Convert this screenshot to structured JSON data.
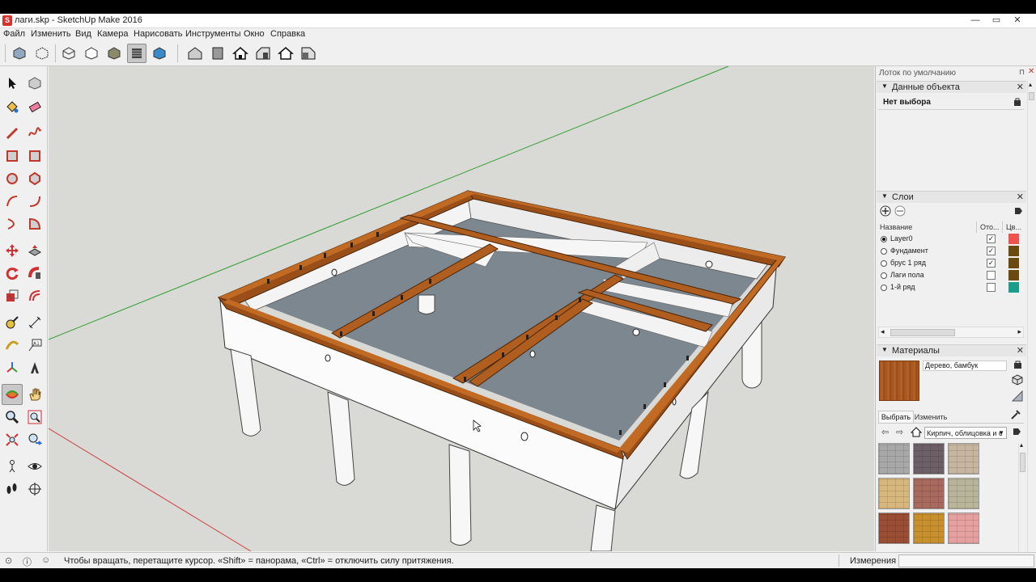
{
  "window": {
    "title": "лаги.skp - SketchUp Make 2016",
    "app_icon_letter": "S",
    "minimize": "—",
    "restore": "▭",
    "close": "✕"
  },
  "menu": [
    "Файл",
    "Изменить",
    "Вид",
    "Камера",
    "Нарисовать",
    "Инструменты",
    "Окно",
    "Справка"
  ],
  "tray": {
    "title": "Лоток по умолчанию",
    "entity_info": {
      "header": "Данные объекта",
      "selection": "Нет выбора"
    },
    "layers": {
      "header": "Слои",
      "col_name": "Название",
      "col_visible": "Ото...",
      "col_color": "Цв...",
      "rows": [
        {
          "name": "Layer0",
          "active": true,
          "visible": true,
          "color": "#ef5350"
        },
        {
          "name": "Фундамент",
          "active": false,
          "visible": true,
          "color": "#6b4a10"
        },
        {
          "name": "брус 1 ряд",
          "active": false,
          "visible": true,
          "color": "#6b4a10"
        },
        {
          "name": "Лаги пола",
          "active": false,
          "visible": false,
          "color": "#6b4a10"
        },
        {
          "name": "1-й ряд",
          "active": false,
          "visible": false,
          "color": "#1a9e8a"
        }
      ]
    },
    "materials": {
      "header": "Материалы",
      "current_name": "Дерево, бамбук",
      "tab_select": "Выбрать",
      "tab_edit": "Изменить",
      "collection": "Кирпич, облицовка и с",
      "swatch_colors": [
        "#a8a8a8",
        "#6d5f66",
        "#c6b6a0",
        "#d8b77d",
        "#a86a5c",
        "#b9b59a",
        "#9a4e34",
        "#c7902d",
        "#e6a0a0"
      ]
    }
  },
  "status": {
    "hint": "Чтобы вращать, перетащите курсор. «Shift» = панорама, «Ctrl» = отключить силу притяжения.",
    "measurements_label": "Измерения",
    "measurements_value": ""
  },
  "colors": {
    "wood": "#9a4f18",
    "wood_light": "#c06a24",
    "wall": "#f7f7f7",
    "floor": "#7c8790",
    "sky": "#d9d9d6",
    "axis_green": "#2e9e2e",
    "axis_red": "#d04040"
  }
}
